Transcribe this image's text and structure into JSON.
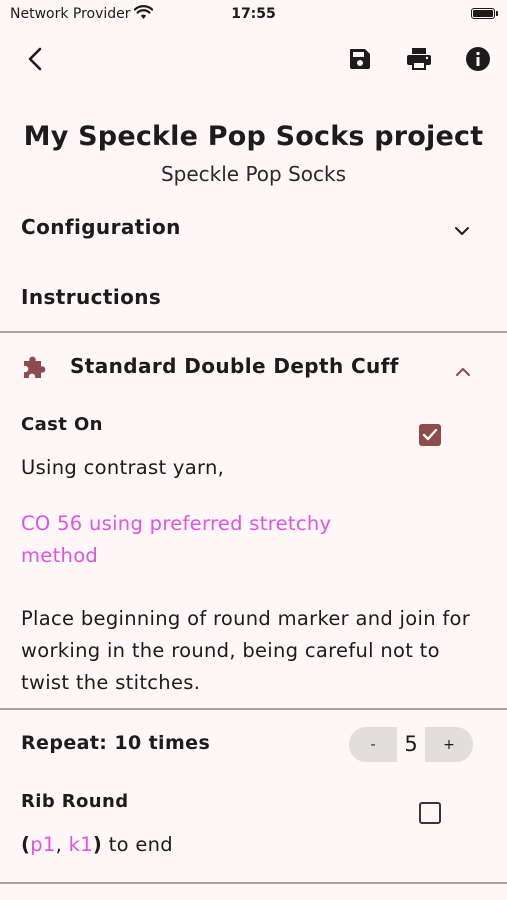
{
  "status_bar": {
    "carrier": "Network Provider",
    "time": "17:55"
  },
  "app_bar": {
    "icons": [
      "back-icon",
      "save-icon",
      "print-icon",
      "info-icon"
    ]
  },
  "header": {
    "title": "My Speckle Pop Socks project",
    "subtitle": "Speckle Pop Socks"
  },
  "sections": {
    "configuration": "Configuration",
    "instructions": "Instructions"
  },
  "cuff": {
    "title": "Standard Double Depth Cuff",
    "icon": "puzzle-piece-icon"
  },
  "cast_on": {
    "label": "Cast On",
    "checked": true,
    "line1": "Using contrast yarn,",
    "line2": "CO 56 using preferred stretchy method",
    "line3": "Place beginning of round marker and join for working in the round, being careful not to twist the stitches."
  },
  "repeat": {
    "label": "Repeat: 10 times",
    "minus": "-",
    "value": "5",
    "plus": "+"
  },
  "rib_round": {
    "label": "Rib Round",
    "checked": false,
    "open_paren": "(",
    "p1": "p1",
    "comma": ", ",
    "k1": "k1",
    "close_paren": ")",
    "rest": " to end"
  },
  "colors": {
    "accent": "#8d4b4c",
    "link": "#e352e6",
    "background": "#fdf7f7"
  }
}
